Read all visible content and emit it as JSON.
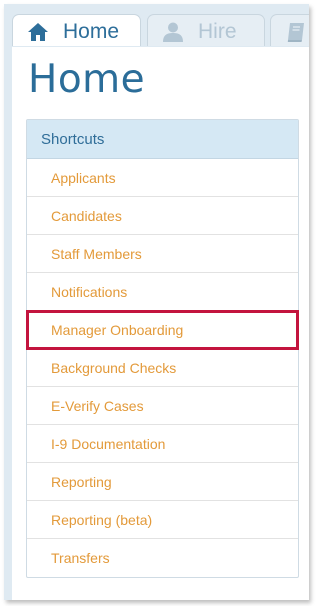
{
  "tabs": [
    {
      "label": "Home",
      "icon": "home-icon",
      "active": true
    },
    {
      "label": "Hire",
      "icon": "user-icon",
      "active": false
    },
    {
      "label": "",
      "icon": "book-icon",
      "active": false
    }
  ],
  "page": {
    "title": "Home"
  },
  "shortcuts": {
    "header": "Shortcuts",
    "items": [
      {
        "label": "Applicants"
      },
      {
        "label": "Candidates"
      },
      {
        "label": "Staff Members"
      },
      {
        "label": "Notifications"
      },
      {
        "label": "Manager Onboarding",
        "highlighted": true
      },
      {
        "label": "Background Checks"
      },
      {
        "label": "E-Verify Cases"
      },
      {
        "label": "I-9 Documentation"
      },
      {
        "label": "Reporting"
      },
      {
        "label": "Reporting (beta)"
      },
      {
        "label": "Transfers"
      }
    ]
  },
  "colors": {
    "accent": "#2b6d99",
    "link": "#e39a3a",
    "highlight": "#c3143e",
    "header_bg": "#d5e8f4"
  }
}
